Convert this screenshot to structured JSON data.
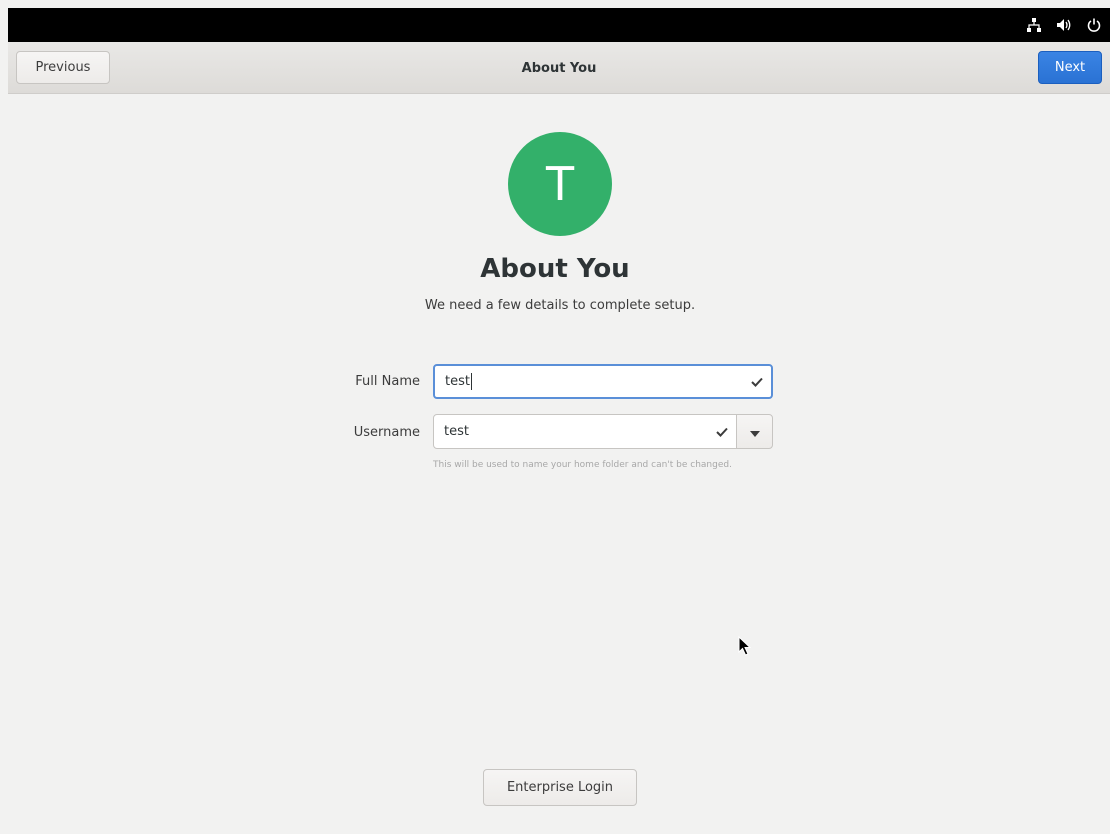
{
  "header": {
    "title": "About You",
    "previous_label": "Previous",
    "next_label": "Next"
  },
  "system_tray": {
    "icons": [
      "network-icon",
      "volume-icon",
      "power-icon"
    ]
  },
  "avatar": {
    "letter": "T",
    "color": "#33b06a"
  },
  "main": {
    "title": "About You",
    "subtitle": "We need a few details to complete setup."
  },
  "form": {
    "full_name_label": "Full Name",
    "full_name_value": "test",
    "username_label": "Username",
    "username_value": "test",
    "username_hint": "This will be used to name your home folder and can't be changed."
  },
  "footer": {
    "enterprise_login_label": "Enterprise Login"
  },
  "colors": {
    "accent": "#2a72d4",
    "focus_border": "#5a8fd8",
    "background": "#f2f2f1"
  }
}
